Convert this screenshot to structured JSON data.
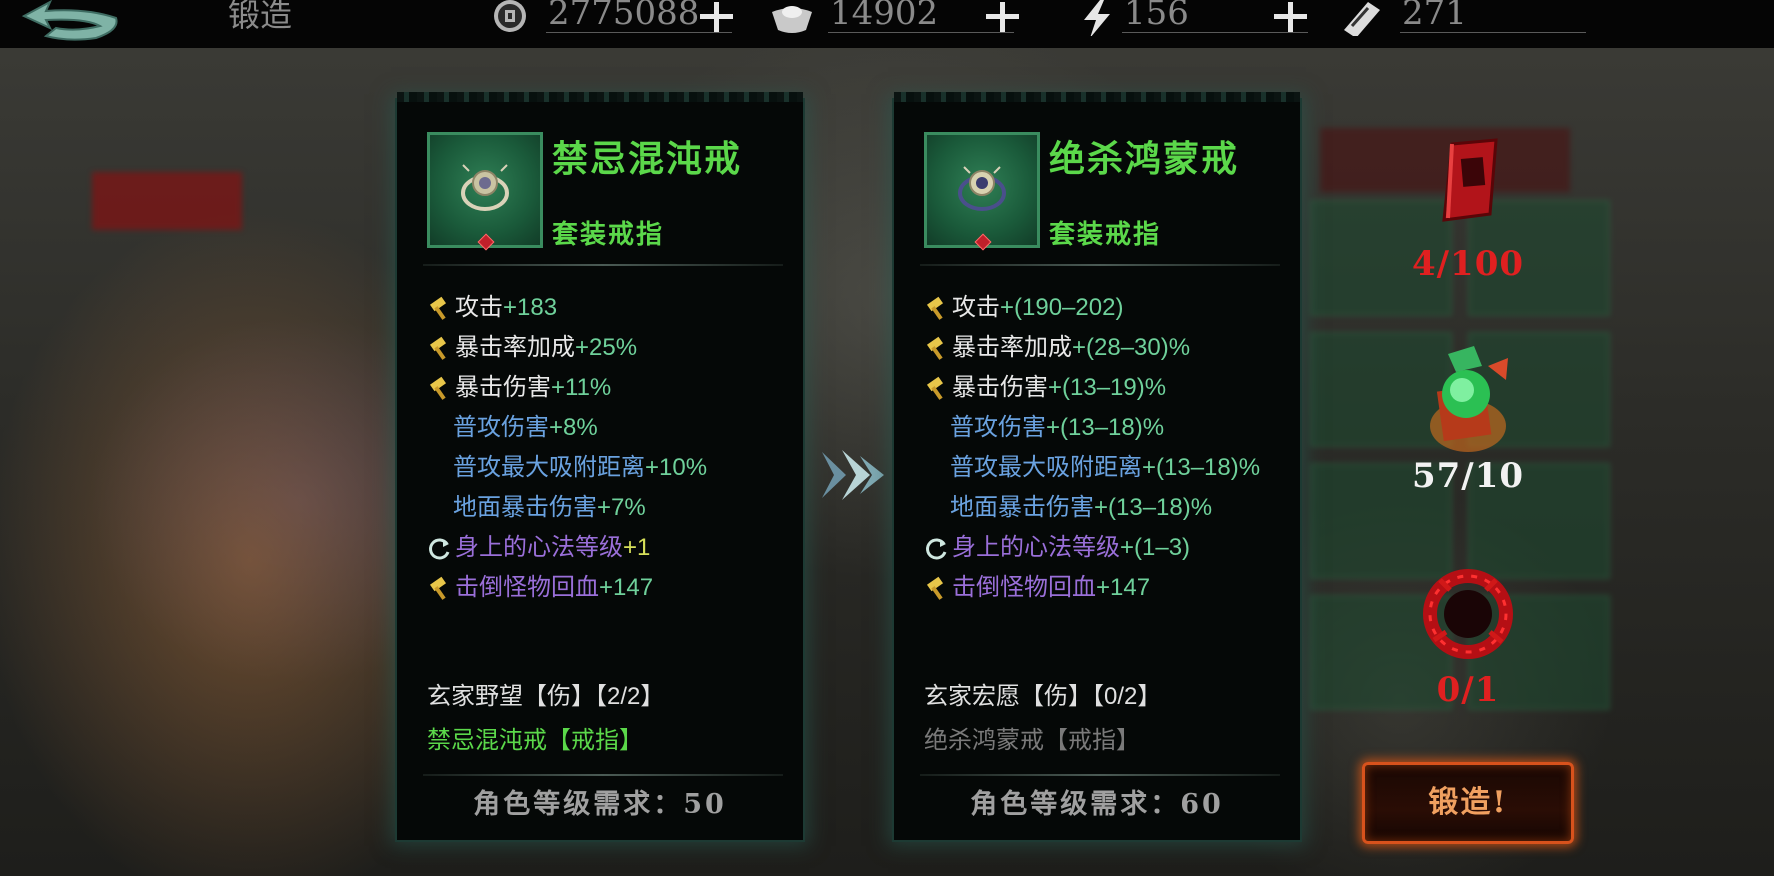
{
  "header": {
    "title": "锻造",
    "resources": [
      {
        "icon": "copper-coin-icon",
        "value": "2775088"
      },
      {
        "icon": "silver-ingot-icon",
        "value": "14902"
      },
      {
        "icon": "lightning-energy-icon",
        "value": "156"
      },
      {
        "icon": "scroll-token-icon",
        "value": "271"
      }
    ]
  },
  "current_item": {
    "name": "禁忌混沌戒",
    "type": "套装戒指",
    "stats": [
      {
        "icon": "hammer-icon",
        "label": "攻击",
        "value": "+183",
        "label_color": "#e8e8e8"
      },
      {
        "icon": "hammer-icon",
        "label": "暴击率加成",
        "value": "+25%",
        "label_color": "#e8e8e8"
      },
      {
        "icon": "hammer-icon",
        "label": "暴击伤害",
        "value": "+11%",
        "label_color": "#e8e8e8"
      },
      {
        "icon": "",
        "label": "普攻伤害",
        "value": "+8%",
        "label_color": "#6aa2e0"
      },
      {
        "icon": "",
        "label": "普攻最大吸附距离",
        "value": "+10%",
        "label_color": "#6aa2e0"
      },
      {
        "icon": "",
        "label": "地面暴击伤害",
        "value": "+7%",
        "label_color": "#6aa2e0"
      },
      {
        "icon": "refresh-icon",
        "label": "身上的心法等级",
        "value": "+1",
        "label_color": "#9a6fd9"
      },
      {
        "icon": "hammer-icon",
        "label": "击倒怪物回血",
        "value": "+147",
        "label_color": "#9a6fd9"
      }
    ],
    "set_name": "玄家野望【伤】【2/2】",
    "set_piece": "禁忌混沌戒【戒指】",
    "requirement": "角色等级需求：50"
  },
  "next_item": {
    "name": "绝杀鸿蒙戒",
    "type": "套装戒指",
    "stats": [
      {
        "icon": "hammer-icon",
        "label": "攻击",
        "value": "+(190–202)",
        "label_color": "#e8e8e8"
      },
      {
        "icon": "hammer-icon",
        "label": "暴击率加成",
        "value": "+(28–30)%",
        "label_color": "#e8e8e8"
      },
      {
        "icon": "hammer-icon",
        "label": "暴击伤害",
        "value": "+(13–19)%",
        "label_color": "#e8e8e8"
      },
      {
        "icon": "",
        "label": "普攻伤害",
        "value": "+(13–18)%",
        "label_color": "#6aa2e0"
      },
      {
        "icon": "",
        "label": "普攻最大吸附距离",
        "value": "+(13–18)%",
        "label_color": "#6aa2e0"
      },
      {
        "icon": "",
        "label": "地面暴击伤害",
        "value": "+(13–18)%",
        "label_color": "#6aa2e0"
      },
      {
        "icon": "refresh-icon",
        "label": "身上的心法等级",
        "value": "+(1–3)",
        "label_color": "#9a6fd9"
      },
      {
        "icon": "hammer-icon",
        "label": "击倒怪物回血",
        "value": "+147",
        "label_color": "#9a6fd9"
      }
    ],
    "set_name": "玄家宏愿【伤】【0/2】",
    "set_piece": "绝杀鸿蒙戒【戒指】",
    "requirement": "角色等级需求：60"
  },
  "materials": [
    {
      "icon": "red-book-icon",
      "count": "4/100",
      "color": "#e02020"
    },
    {
      "icon": "green-jade-crystal-icon",
      "count": "57/10",
      "color": "#f2f2f2"
    },
    {
      "icon": "red-thorn-ring-icon",
      "count": "0/1",
      "color": "#e02020"
    }
  ],
  "actions": {
    "forge_label": "锻造!"
  },
  "colors": {
    "item_name": "#5bd84a",
    "value_green": "#6fd19b",
    "value_yellow": "#d7e05a",
    "set_piece_active": "#5bd84a",
    "set_piece_inactive": "#7a7a7a"
  }
}
